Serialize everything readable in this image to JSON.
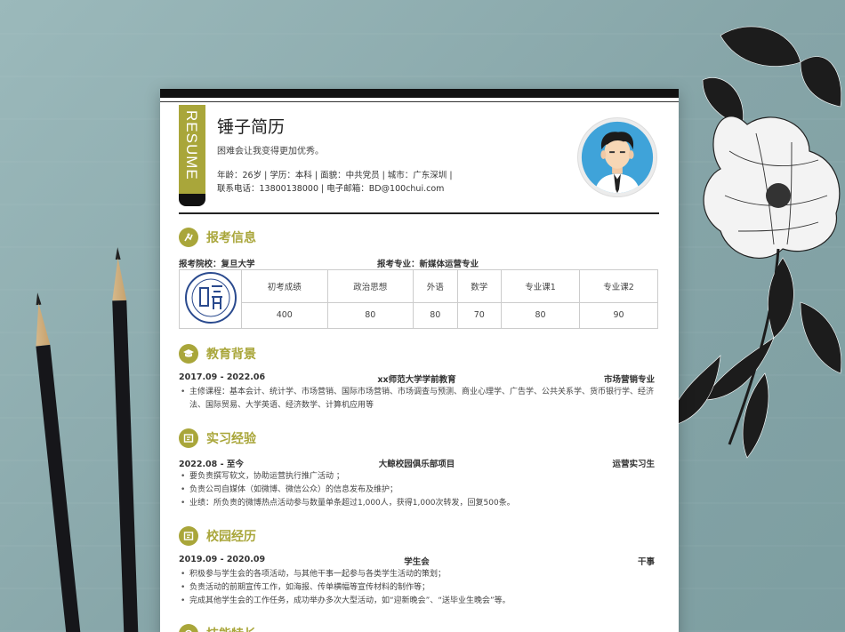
{
  "resume": {
    "tab": "RESUME",
    "name": "锤子简历",
    "motto": "困难会让我变得更加优秀。",
    "meta_line1": "年龄：26岁 | 学历：本科 | 面貌：中共党员 | 城市：广东深圳 |",
    "meta_line2": "联系电话：13800138000 | 电子邮箱：BD@100chui.com"
  },
  "exam": {
    "title": "报考信息",
    "school": "报考院校：复旦大学",
    "major": "报考专业：新媒体运营专业",
    "headers": [
      "初考成绩",
      "政治思想",
      "外语",
      "数学",
      "专业课1",
      "专业课2"
    ],
    "values": [
      "400",
      "80",
      "80",
      "70",
      "80",
      "90"
    ]
  },
  "education": {
    "title": "教育背景",
    "period": "2017.09 - 2022.06",
    "school": "xx师范大学学前教育",
    "major": "市场营销专业",
    "bullets": [
      "主修课程：基本会计、统计学、市场营销、国际市场营销、市场调查与预测、商业心理学、广告学、公共关系学、货币银行学、经济法、国际贸易、大学英语、经济数学、计算机应用等"
    ]
  },
  "internship": {
    "title": "实习经验",
    "period": "2022.08 - 至今",
    "org": "大鲸校园俱乐部项目",
    "role": "运营实习生",
    "bullets": [
      "要负责撰写软文，协助运营执行推广活动 ；",
      "负责公司自媒体（如微博、微信公众）的信息发布及维护；",
      "业绩：所负责的微博热点活动参与数量单条超过1,000人，获得1,000次转发，回复500条。"
    ]
  },
  "campus": {
    "title": "校园经历",
    "period": "2019.09 - 2020.09",
    "org": "学生会",
    "role": "干事",
    "bullets": [
      "积极参与学生会的各项活动，与其他干事一起参与各类学生活动的策划；",
      "负责活动的前期宣传工作，如海报、传单横幅等宣传材料的制作等；",
      "完成其他学生会的工作任务，成功举办多次大型活动，如“迎新晚会”、“送毕业生晚会”等。"
    ]
  },
  "skills": {
    "title": "技能特长"
  },
  "colors": {
    "accent": "#a9a63a",
    "background": "#8faeb0"
  }
}
